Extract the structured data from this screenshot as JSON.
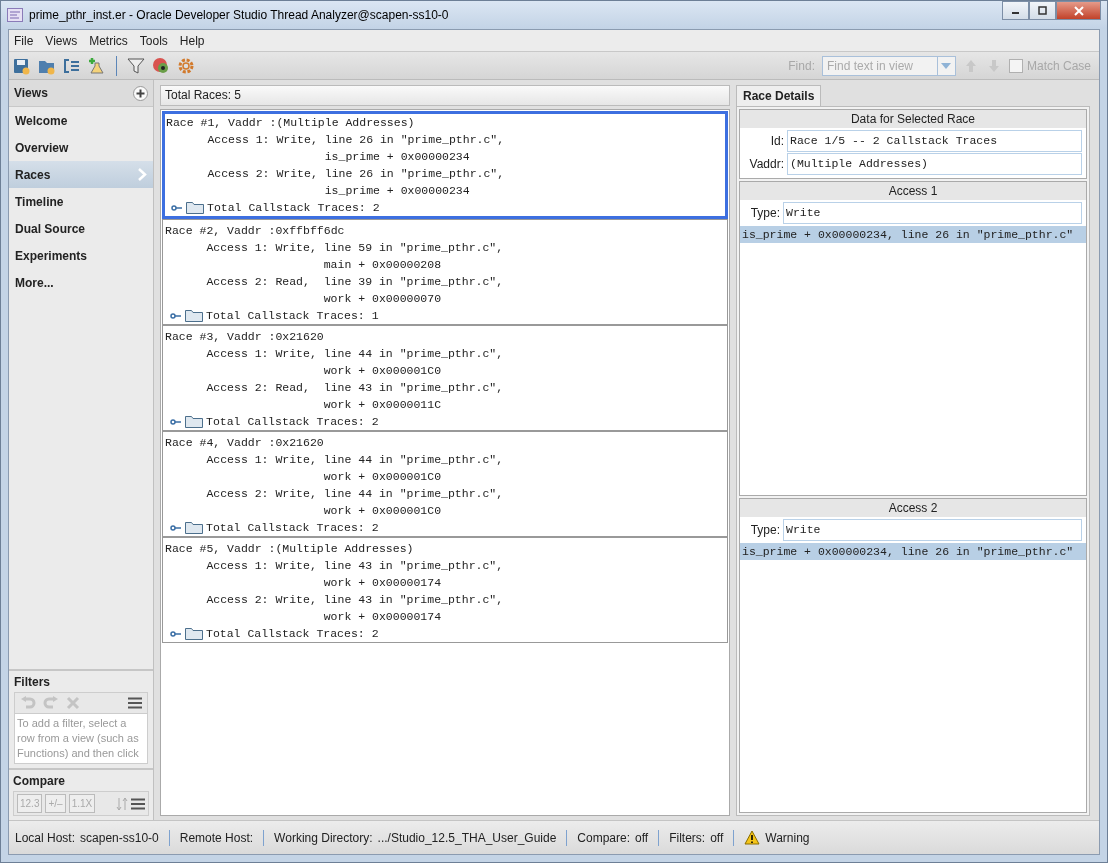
{
  "window": {
    "title": "prime_pthr_inst.er  -  Oracle Developer Studio Thread Analyzer@scapen-ss10-0"
  },
  "menu": [
    "File",
    "Views",
    "Metrics",
    "Tools",
    "Help"
  ],
  "find": {
    "label": "Find:",
    "placeholder": "Find text in view",
    "match_case": {
      "label": "Match Case",
      "checked": false
    }
  },
  "sidebar": {
    "title": "Views",
    "items": [
      {
        "label": "Welcome",
        "selected": false
      },
      {
        "label": "Overview",
        "selected": false
      },
      {
        "label": "Races",
        "selected": true
      },
      {
        "label": "Timeline",
        "selected": false
      },
      {
        "label": "Dual Source",
        "selected": false
      },
      {
        "label": "Experiments",
        "selected": false
      },
      {
        "label": "More...",
        "selected": false
      }
    ]
  },
  "filters": {
    "title": "Filters",
    "hint": "To add a filter, select a row from a view (such as Functions) and then click"
  },
  "compare": {
    "title": "Compare",
    "buttons": [
      "12.3",
      "+/–",
      "1.1X"
    ]
  },
  "races": {
    "summary": "Total Races: 5",
    "items": [
      {
        "header": "Race #1, Vaddr :(Multiple Addresses)",
        "accesses": [
          {
            "line": "Access 1: Write, line 26 in \"prime_pthr.c\",",
            "location": "is_prime + 0x00000234"
          },
          {
            "line": "Access 2: Write, line 26 in \"prime_pthr.c\",",
            "location": "is_prime + 0x00000234"
          }
        ],
        "traces": "Total Callstack Traces: 2",
        "selected": true
      },
      {
        "header": "Race #2, Vaddr :0xffbff6dc",
        "accesses": [
          {
            "line": "Access 1: Write, line 59 in \"prime_pthr.c\",",
            "location": "main + 0x00000208"
          },
          {
            "line": "Access 2: Read,  line 39 in \"prime_pthr.c\",",
            "location": "work + 0x00000070"
          }
        ],
        "traces": "Total Callstack Traces: 1",
        "selected": false
      },
      {
        "header": "Race #3, Vaddr :0x21620",
        "accesses": [
          {
            "line": "Access 1: Write, line 44 in \"prime_pthr.c\",",
            "location": "work + 0x000001C0"
          },
          {
            "line": "Access 2: Read,  line 43 in \"prime_pthr.c\",",
            "location": "work + 0x0000011C"
          }
        ],
        "traces": "Total Callstack Traces: 2",
        "selected": false
      },
      {
        "header": "Race #4, Vaddr :0x21620",
        "accesses": [
          {
            "line": "Access 1: Write, line 44 in \"prime_pthr.c\",",
            "location": "work + 0x000001C0"
          },
          {
            "line": "Access 2: Write, line 44 in \"prime_pthr.c\",",
            "location": "work + 0x000001C0"
          }
        ],
        "traces": "Total Callstack Traces: 2",
        "selected": false
      },
      {
        "header": "Race #5, Vaddr :(Multiple Addresses)",
        "accesses": [
          {
            "line": "Access 1: Write, line 43 in \"prime_pthr.c\",",
            "location": "work + 0x00000174"
          },
          {
            "line": "Access 2: Write, line 43 in \"prime_pthr.c\",",
            "location": "work + 0x00000174"
          }
        ],
        "traces": "Total Callstack Traces: 2",
        "selected": false
      }
    ]
  },
  "details": {
    "tab": "Race Details",
    "title": "Data for Selected Race",
    "id_label": "Id:",
    "id": "Race 1/5 -- 2 Callstack Traces",
    "vaddr_label": "Vaddr:",
    "vaddr": "(Multiple Addresses)",
    "accesses": [
      {
        "title": "Access 1",
        "type_label": "Type:",
        "type": "Write",
        "frames": [
          {
            "text": "is_prime + 0x00000234, line 26 in \"prime_pthr.c\"",
            "selected": true
          }
        ]
      },
      {
        "title": "Access 2",
        "type_label": "Type:",
        "type": "Write",
        "frames": [
          {
            "text": "is_prime + 0x00000234, line 26 in \"prime_pthr.c\"",
            "selected": true
          }
        ]
      }
    ]
  },
  "status_bar": [
    {
      "kind": "field",
      "label": "Local Host:",
      "value": "scapen-ss10-0"
    },
    {
      "kind": "field",
      "label": "Remote Host:"
    },
    {
      "kind": "field",
      "label": "Working Directory:",
      "value": ".../Studio_12.5_THA_User_Guide"
    },
    {
      "kind": "field",
      "label": "Compare:",
      "value": "off"
    },
    {
      "kind": "field",
      "label": "Filters:",
      "value": "off"
    },
    {
      "kind": "warning",
      "label": "Warning"
    }
  ]
}
